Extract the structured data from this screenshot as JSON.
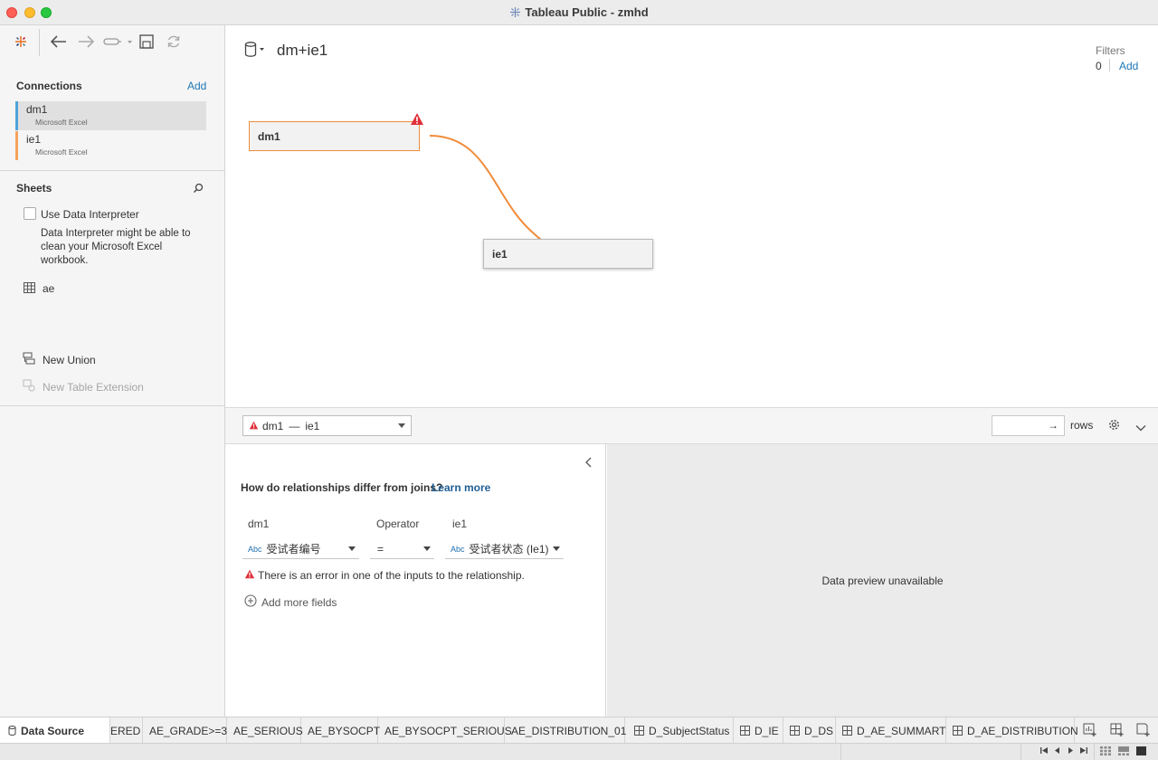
{
  "window": {
    "title": "Tableau Public - zmhd"
  },
  "toolbar": {
    "back": "back-arrow-icon",
    "forward": "forward-arrow-icon",
    "connect": "connect-icon",
    "save": "save-icon",
    "refresh": "refresh-icon"
  },
  "connections": {
    "title": "Connections",
    "add_label": "Add",
    "items": [
      {
        "name": "dm1",
        "type": "Microsoft Excel",
        "color": "#4fa3d8"
      },
      {
        "name": "ie1",
        "type": "Microsoft Excel",
        "color": "#f5a25d"
      }
    ]
  },
  "sheets": {
    "title": "Sheets",
    "use_data_interpreter": "Use Data Interpreter",
    "interpreter_note": "Data Interpreter might be able to clean your Microsoft Excel workbook.",
    "items": [
      {
        "name": "ae"
      }
    ],
    "new_union": "New Union",
    "new_table_extension": "New Table Extension"
  },
  "canvas": {
    "datasource_name": "dm+ie1",
    "filters_label": "Filters",
    "filters_count": "0",
    "filters_add": "Add",
    "tables": [
      {
        "name": "dm1",
        "has_error": true
      },
      {
        "name": "ie1"
      }
    ],
    "accent": "#f08c3b"
  },
  "relationship": {
    "selector_left": "dm1",
    "selector_sep": "—",
    "selector_right": "ie1",
    "rows_arrow": "→",
    "rows_label": "rows",
    "question": "How do relationships differ from joins?",
    "learn_more": "Learn more",
    "left_header": "dm1",
    "operator_header": "Operator",
    "right_header": "ie1",
    "left_field_type": "Abc",
    "left_field": "受试者编号",
    "operator": "=",
    "right_field_type": "Abc",
    "right_field": "受试者状态 (Ie1)",
    "error_text": "There is an error in one of the inputs to the relationship.",
    "add_more_fields": "Add more fields",
    "preview_message": "Data preview unavailable",
    "error_color": "#e0303a"
  },
  "tabs": {
    "data_source": "Data Source",
    "sheets": [
      {
        "label": "ERED",
        "icon": ""
      },
      {
        "label": "AE_GRADE>=3",
        "icon": ""
      },
      {
        "label": "AE_SERIOUS",
        "icon": ""
      },
      {
        "label": "AE_BYSOCPT",
        "icon": ""
      },
      {
        "label": "AE_BYSOCPT_SERIOUS",
        "icon": ""
      },
      {
        "label": "AE_DISTRIBUTION_01",
        "icon": ""
      },
      {
        "label": "D_SubjectStatus",
        "icon": "dashboard-icon"
      },
      {
        "label": "D_IE",
        "icon": "dashboard-icon"
      },
      {
        "label": "D_DS",
        "icon": "dashboard-icon"
      },
      {
        "label": "D_AE_SUMMART",
        "icon": "dashboard-icon"
      },
      {
        "label": "D_AE_DISTRIBUTION",
        "icon": "dashboard-icon"
      }
    ]
  }
}
